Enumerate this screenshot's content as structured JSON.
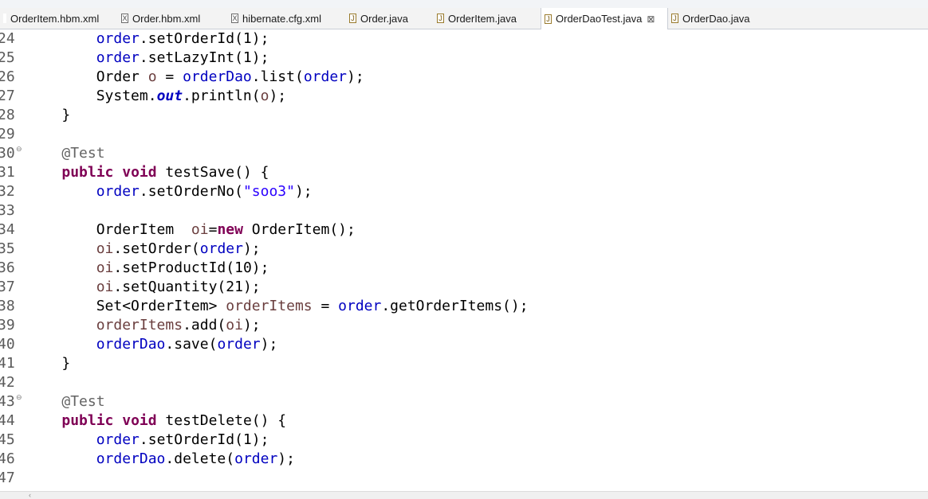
{
  "tabs": [
    {
      "label": "OrderItem.hbm.xml",
      "icon": "xml-file-icon",
      "icon_glyph": "",
      "active": false
    },
    {
      "label": "Order.hbm.xml",
      "icon": "xml-file-icon",
      "icon_glyph": "X",
      "active": false
    },
    {
      "label": "hibernate.cfg.xml",
      "icon": "xml-file-icon",
      "icon_glyph": "X",
      "active": false
    },
    {
      "label": "Order.java",
      "icon": "java-file-icon",
      "icon_glyph": "J",
      "active": false
    },
    {
      "label": "OrderItem.java",
      "icon": "java-file-icon",
      "icon_glyph": "J",
      "active": false
    },
    {
      "label": "OrderDaoTest.java",
      "icon": "java-file-icon",
      "icon_glyph": "J",
      "active": true,
      "close": "⊠"
    },
    {
      "label": "OrderDao.java",
      "icon": "java-file-icon",
      "icon_glyph": "J",
      "active": false
    }
  ],
  "editor": {
    "lines": [
      {
        "no": "24",
        "fold": "",
        "tokens": [
          {
            "t": "        "
          },
          {
            "t": "order",
            "c": "fld"
          },
          {
            "t": ".setOrderId(1);"
          }
        ]
      },
      {
        "no": "25",
        "fold": "",
        "tokens": [
          {
            "t": "        "
          },
          {
            "t": "order",
            "c": "fld"
          },
          {
            "t": ".setLazyInt(1);"
          }
        ]
      },
      {
        "no": "26",
        "fold": "",
        "tokens": [
          {
            "t": "        Order "
          },
          {
            "t": "o",
            "c": "lv"
          },
          {
            "t": " = "
          },
          {
            "t": "orderDao",
            "c": "fld"
          },
          {
            "t": ".list("
          },
          {
            "t": "order",
            "c": "fld"
          },
          {
            "t": ");"
          }
        ]
      },
      {
        "no": "27",
        "fold": "",
        "tokens": [
          {
            "t": "        System."
          },
          {
            "t": "out",
            "c": "sfld"
          },
          {
            "t": ".println("
          },
          {
            "t": "o",
            "c": "lv"
          },
          {
            "t": ");"
          }
        ]
      },
      {
        "no": "28",
        "fold": "",
        "tokens": [
          {
            "t": "    }"
          }
        ]
      },
      {
        "no": "29",
        "fold": "",
        "tokens": []
      },
      {
        "no": "30",
        "fold": "⊖",
        "tokens": [
          {
            "t": "    "
          },
          {
            "t": "@Test",
            "c": "ann"
          }
        ]
      },
      {
        "no": "31",
        "fold": "",
        "tokens": [
          {
            "t": "    "
          },
          {
            "t": "public",
            "c": "kw"
          },
          {
            "t": " "
          },
          {
            "t": "void",
            "c": "kw"
          },
          {
            "t": " testSave() {"
          }
        ]
      },
      {
        "no": "32",
        "fold": "",
        "tokens": [
          {
            "t": "        "
          },
          {
            "t": "order",
            "c": "fld"
          },
          {
            "t": ".setOrderNo("
          },
          {
            "t": "\"soo3\"",
            "c": "str"
          },
          {
            "t": ");"
          }
        ]
      },
      {
        "no": "33",
        "fold": "",
        "tokens": []
      },
      {
        "no": "34",
        "fold": "",
        "tokens": [
          {
            "t": "        OrderItem  "
          },
          {
            "t": "oi",
            "c": "lv"
          },
          {
            "t": "="
          },
          {
            "t": "new",
            "c": "kw"
          },
          {
            "t": " OrderItem();"
          }
        ]
      },
      {
        "no": "35",
        "fold": "",
        "tokens": [
          {
            "t": "        "
          },
          {
            "t": "oi",
            "c": "lv"
          },
          {
            "t": ".setOrder("
          },
          {
            "t": "order",
            "c": "fld"
          },
          {
            "t": ");"
          }
        ]
      },
      {
        "no": "36",
        "fold": "",
        "tokens": [
          {
            "t": "        "
          },
          {
            "t": "oi",
            "c": "lv"
          },
          {
            "t": ".setProductId(10);"
          }
        ]
      },
      {
        "no": "37",
        "fold": "",
        "tokens": [
          {
            "t": "        "
          },
          {
            "t": "oi",
            "c": "lv"
          },
          {
            "t": ".setQuantity(21);"
          }
        ]
      },
      {
        "no": "38",
        "fold": "",
        "tokens": [
          {
            "t": "        Set<OrderItem> "
          },
          {
            "t": "orderItems",
            "c": "lv"
          },
          {
            "t": " = "
          },
          {
            "t": "order",
            "c": "fld"
          },
          {
            "t": ".getOrderItems();"
          }
        ]
      },
      {
        "no": "39",
        "fold": "",
        "tokens": [
          {
            "t": "        "
          },
          {
            "t": "orderItems",
            "c": "lv"
          },
          {
            "t": ".add("
          },
          {
            "t": "oi",
            "c": "lv"
          },
          {
            "t": ");"
          }
        ]
      },
      {
        "no": "40",
        "fold": "",
        "tokens": [
          {
            "t": "        "
          },
          {
            "t": "orderDao",
            "c": "fld"
          },
          {
            "t": ".save("
          },
          {
            "t": "order",
            "c": "fld"
          },
          {
            "t": ");"
          }
        ]
      },
      {
        "no": "41",
        "fold": "",
        "tokens": [
          {
            "t": "    }"
          }
        ]
      },
      {
        "no": "42",
        "fold": "",
        "tokens": []
      },
      {
        "no": "43",
        "fold": "⊖",
        "tokens": [
          {
            "t": "    "
          },
          {
            "t": "@Test",
            "c": "ann"
          }
        ]
      },
      {
        "no": "44",
        "fold": "",
        "tokens": [
          {
            "t": "    "
          },
          {
            "t": "public",
            "c": "kw"
          },
          {
            "t": " "
          },
          {
            "t": "void",
            "c": "kw"
          },
          {
            "t": " testDelete() {"
          }
        ]
      },
      {
        "no": "45",
        "fold": "",
        "tokens": [
          {
            "t": "        "
          },
          {
            "t": "order",
            "c": "fld"
          },
          {
            "t": ".setOrderId(1);"
          }
        ]
      },
      {
        "no": "46",
        "fold": "",
        "tokens": [
          {
            "t": "        "
          },
          {
            "t": "orderDao",
            "c": "fld"
          },
          {
            "t": ".delete("
          },
          {
            "t": "order",
            "c": "fld"
          },
          {
            "t": ");"
          }
        ]
      },
      {
        "no": "47",
        "fold": "",
        "tokens": []
      }
    ]
  },
  "scrollbar": {
    "left_arrow": "‹"
  }
}
